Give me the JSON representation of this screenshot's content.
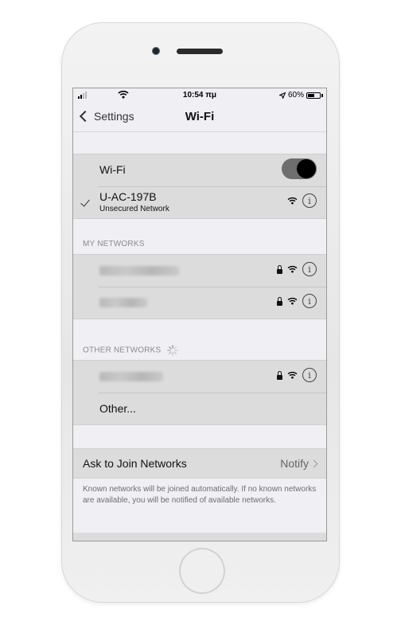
{
  "status_bar": {
    "time": "10:54 πμ",
    "battery": "60%",
    "battery_level": 0.6
  },
  "nav": {
    "back_label": "Settings",
    "title": "Wi-Fi"
  },
  "wifi": {
    "toggle_label": "Wi-Fi",
    "toggle_on": true,
    "connected_network": {
      "name": "U-AC-197B",
      "subtitle": "Unsecured Network"
    }
  },
  "my_networks": {
    "header": "MY NETWORKS",
    "items": [
      {
        "name": "Network_Name1",
        "obscured": true,
        "locked": true
      },
      {
        "name": "Network2",
        "obscured": true,
        "locked": true
      }
    ]
  },
  "other_networks": {
    "header": "OTHER NETWORKS",
    "items": [
      {
        "name": "Network_3",
        "obscured": true,
        "locked": true
      }
    ],
    "other_label": "Other..."
  },
  "ask_to_join": {
    "label": "Ask to Join Networks",
    "value": "Notify",
    "description": "Known networks will be joined automatically. If no known networks are available, you will be notified of available networks."
  },
  "icons": {
    "info": "i"
  },
  "colors": {
    "toggle_track": "#6e6e6e",
    "toggle_knob": "#000000",
    "group_bg": "#dcdcdc",
    "screen_bg": "#efeff4"
  }
}
